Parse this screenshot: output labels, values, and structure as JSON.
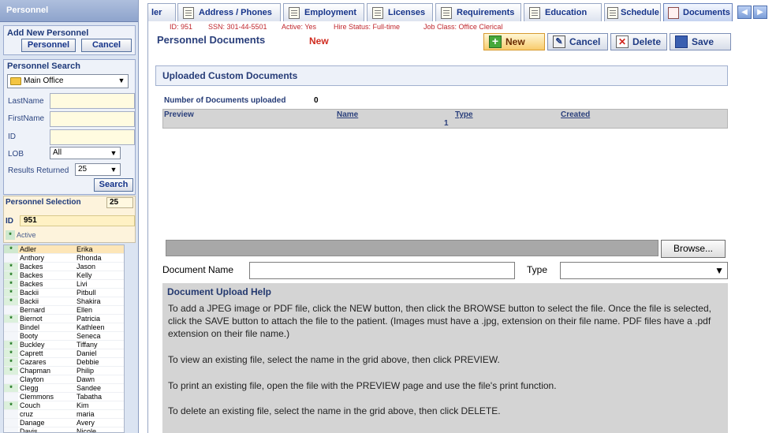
{
  "left": {
    "header": "Personnel",
    "add_new": {
      "title": "Add New Personnel",
      "personnel_btn": "Personnel",
      "cancel_btn": "Cancel"
    },
    "search": {
      "title": "Personnel Search",
      "office": "Main Office",
      "last_name_label": "LastName",
      "first_name_label": "FirstName",
      "id_label": "ID",
      "lob_label": "LOB",
      "lob_value": "All",
      "results_label": "Results Returned",
      "results_value": "25",
      "search_btn": "Search"
    },
    "selection": {
      "title": "Personnel Selection",
      "count": "25",
      "id_label": "ID",
      "id_value": "951",
      "active_flag": "*",
      "active_label": "Active"
    },
    "rows": [
      {
        "flag": "*",
        "last": "Adler",
        "first": "Erika"
      },
      {
        "flag": "",
        "last": "Anthory",
        "first": "Rhonda"
      },
      {
        "flag": "*",
        "last": "Backes",
        "first": "Jason"
      },
      {
        "flag": "*",
        "last": "Backes",
        "first": "Kelly"
      },
      {
        "flag": "*",
        "last": "Backes",
        "first": "Livi"
      },
      {
        "flag": "*",
        "last": "Backii",
        "first": "Pitbull"
      },
      {
        "flag": "*",
        "last": "Backii",
        "first": "Shakira"
      },
      {
        "flag": "",
        "last": "Bernard",
        "first": "Ellen"
      },
      {
        "flag": "*",
        "last": "Biernot",
        "first": "Patricia"
      },
      {
        "flag": "",
        "last": "Bindel",
        "first": "Kathleen"
      },
      {
        "flag": "",
        "last": "Booty",
        "first": "Seneca"
      },
      {
        "flag": "*",
        "last": "Buckley",
        "first": "Tiffany"
      },
      {
        "flag": "*",
        "last": "Caprett",
        "first": "Daniel"
      },
      {
        "flag": "*",
        "last": "Cazares",
        "first": "Debbie"
      },
      {
        "flag": "*",
        "last": "Chapman",
        "first": "Philip"
      },
      {
        "flag": "",
        "last": "Clayton",
        "first": "Dawn"
      },
      {
        "flag": "*",
        "last": "Clegg",
        "first": "Sandee"
      },
      {
        "flag": "",
        "last": "Clemmons",
        "first": "Tabatha"
      },
      {
        "flag": "*",
        "last": "Couch",
        "first": "Kim"
      },
      {
        "flag": "",
        "last": "cruz",
        "first": "maria"
      },
      {
        "flag": "",
        "last": "Danage",
        "first": "Avery"
      },
      {
        "flag": "",
        "last": "Davis",
        "first": "Nicole"
      }
    ]
  },
  "tabs": [
    {
      "label": "ler"
    },
    {
      "label": "Address / Phones"
    },
    {
      "label": "Employment"
    },
    {
      "label": "Licenses"
    },
    {
      "label": "Requirements"
    },
    {
      "label": "Education"
    },
    {
      "label": "Schedule"
    },
    {
      "label": "Documents"
    }
  ],
  "info": {
    "id": "ID: 951",
    "ssn": "SSN: 301-44-5501",
    "active": "Active: Yes",
    "hire": "Hire Status: Full-time",
    "job": "Job Class: Office Clerical"
  },
  "page": {
    "title": "Personnel Documents",
    "badge": "New",
    "buttons": {
      "new": "New",
      "cancel": "Cancel",
      "delete": "Delete",
      "save": "Save"
    }
  },
  "uploaded": {
    "header": "Uploaded Custom Documents",
    "count_label": "Number of Documents uploaded",
    "count_value": "0",
    "columns": [
      "Preview",
      "Name",
      "Type",
      "Created"
    ],
    "page_number": "1"
  },
  "upload": {
    "browse": "Browse...",
    "doc_name_label": "Document Name",
    "type_label": "Type"
  },
  "help": {
    "title": "Document Upload Help",
    "p1": "To add a JPEG image or PDF file, click the NEW button, then click the BROWSE button to select the file. Once the file is selected, click the SAVE button to attach the file to the patient. (Images must have a .jpg, extension on their file name. PDF files have a .pdf extension on their file name.)",
    "p2": "To view an existing file, select the name in the grid above, then click PREVIEW.",
    "p3": "To print an existing file, open the file with the PREVIEW page and use the file's print function.",
    "p4": "To delete an existing file, select the name in the grid above, then click DELETE."
  }
}
